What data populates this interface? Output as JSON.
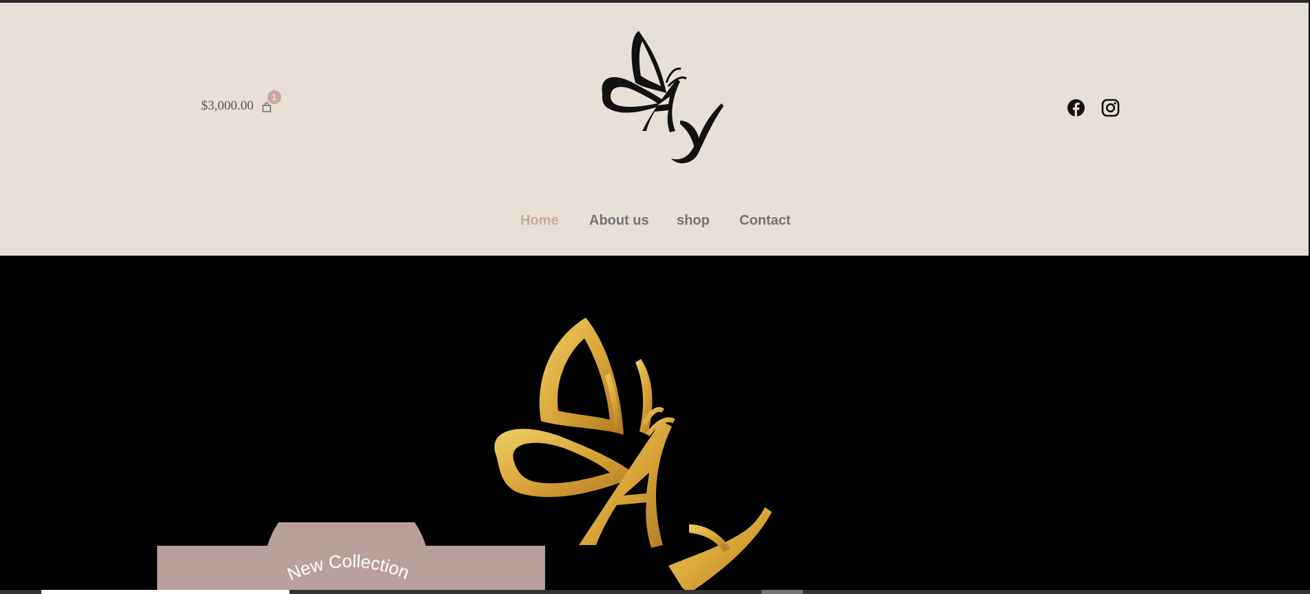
{
  "header": {
    "cart": {
      "total": "$3,000.00",
      "count": "1"
    },
    "nav": [
      {
        "label": "Home",
        "active": true
      },
      {
        "label": "About us",
        "active": false
      },
      {
        "label": "shop",
        "active": false
      },
      {
        "label": "Contact",
        "active": false
      }
    ],
    "social": {
      "icons": [
        "facebook-icon",
        "instagram-icon"
      ]
    }
  },
  "hero": {
    "promo_text": "New Collection"
  },
  "colors": {
    "header_bg": "#e8dfd6",
    "nav_active": "#c9a89e",
    "nav_text": "#737373",
    "badge": "#c7a9a0",
    "promo_bg": "#b8a19a",
    "gold": "#d9a63a",
    "hero_bg": "#000000"
  }
}
